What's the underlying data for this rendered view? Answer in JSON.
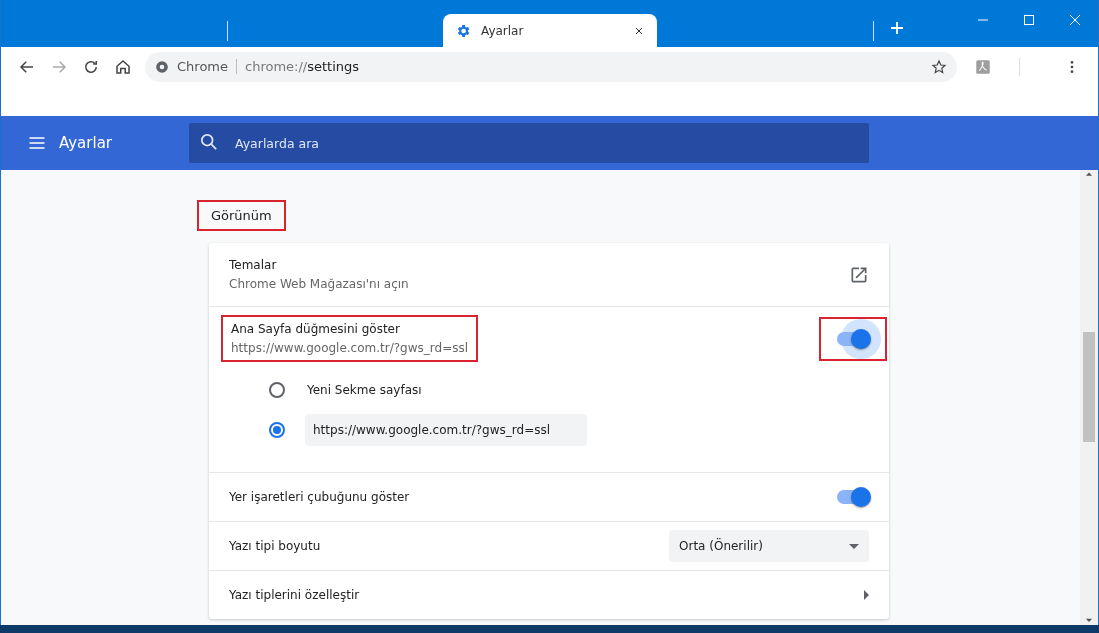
{
  "window": {
    "tab": {
      "title": "Ayarlar",
      "selected": true
    }
  },
  "toolbar": {
    "origin": "Chrome",
    "url_scheme": "chrome://",
    "url_path": "settings"
  },
  "header": {
    "title": "Ayarlar",
    "search": {
      "placeholder": "Ayarlarda ara"
    }
  },
  "section": {
    "title": "Görünüm",
    "highlighted": true,
    "rows": [
      {
        "kind": "link",
        "label": "Temalar",
        "sublabel": "Chrome Web Mağazası'nı açın"
      },
      {
        "kind": "toggle",
        "label": "Ana Sayfa düğmesini göster",
        "sublabel": "https://www.google.com.tr/?gws_rd=ssl",
        "on": true,
        "focused": true,
        "highlighted": true,
        "options": [
          {
            "kind": "text",
            "label": "Yeni Sekme sayfası",
            "selected": false
          },
          {
            "kind": "field",
            "value": "https://www.google.com.tr/?gws_rd=ssl",
            "selected": true
          }
        ]
      },
      {
        "kind": "toggle",
        "label": "Yer işaretleri çubuğunu göster",
        "on": true,
        "focused": false,
        "highlighted": false
      },
      {
        "kind": "select",
        "label": "Yazı tipi boyutu",
        "value": "Orta (Önerilir)"
      },
      {
        "kind": "submenu",
        "label": "Yazı tiplerini özelleştir"
      }
    ]
  }
}
